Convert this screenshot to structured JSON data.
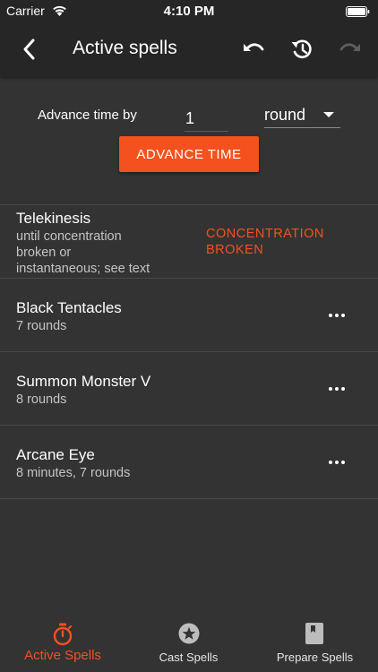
{
  "status_bar": {
    "carrier": "Carrier",
    "time": "4:10 PM"
  },
  "nav": {
    "title": "Active spells",
    "icons": [
      "back-icon",
      "undo-icon",
      "history-icon",
      "redo-icon"
    ]
  },
  "advance": {
    "label": "Advance time by",
    "amount": "1",
    "unit": "round",
    "button_label": "ADVANCE TIME"
  },
  "spells": [
    {
      "name": "Telekinesis",
      "duration_lines": [
        "until concentration",
        "broken or",
        "instantaneous; see text"
      ],
      "status_lines": [
        "CONCENTRATION",
        "BROKEN"
      ]
    },
    {
      "name": "Black Tentacles",
      "duration": "7 rounds"
    },
    {
      "name": "Summon Monster V",
      "duration": "8 rounds"
    },
    {
      "name": "Arcane Eye",
      "duration": "8 minutes, 7 rounds"
    }
  ],
  "tabs": [
    {
      "label": "Active Spells",
      "icon": "stopwatch-icon",
      "active": true
    },
    {
      "label": "Cast Spells",
      "icon": "star-icon",
      "active": false
    },
    {
      "label": "Prepare Spells",
      "icon": "spellbook-icon",
      "active": false
    }
  ],
  "colors": {
    "accent": "#f4511e",
    "background": "#333333",
    "bar": "#262626",
    "inactive_icon": "#bdbdbd",
    "disabled_icon": "#5e5e5e"
  }
}
